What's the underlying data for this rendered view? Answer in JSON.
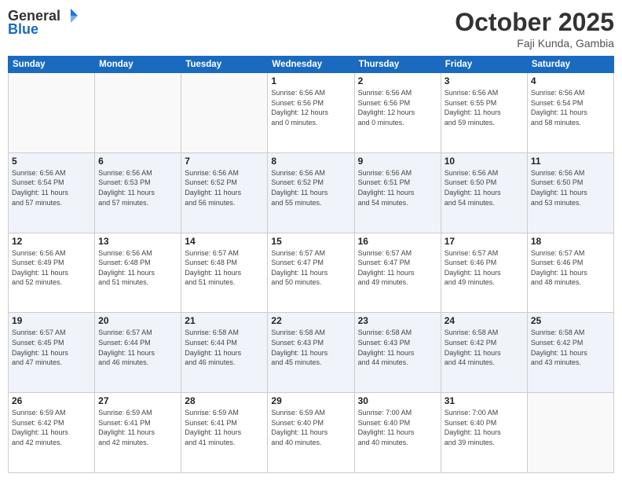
{
  "header": {
    "logo_line1": "General",
    "logo_line2": "Blue",
    "month": "October 2025",
    "location": "Faji Kunda, Gambia"
  },
  "days_of_week": [
    "Sunday",
    "Monday",
    "Tuesday",
    "Wednesday",
    "Thursday",
    "Friday",
    "Saturday"
  ],
  "weeks": [
    [
      {
        "num": "",
        "info": ""
      },
      {
        "num": "",
        "info": ""
      },
      {
        "num": "",
        "info": ""
      },
      {
        "num": "1",
        "info": "Sunrise: 6:56 AM\nSunset: 6:56 PM\nDaylight: 12 hours\nand 0 minutes."
      },
      {
        "num": "2",
        "info": "Sunrise: 6:56 AM\nSunset: 6:56 PM\nDaylight: 12 hours\nand 0 minutes."
      },
      {
        "num": "3",
        "info": "Sunrise: 6:56 AM\nSunset: 6:55 PM\nDaylight: 11 hours\nand 59 minutes."
      },
      {
        "num": "4",
        "info": "Sunrise: 6:56 AM\nSunset: 6:54 PM\nDaylight: 11 hours\nand 58 minutes."
      }
    ],
    [
      {
        "num": "5",
        "info": "Sunrise: 6:56 AM\nSunset: 6:54 PM\nDaylight: 11 hours\nand 57 minutes."
      },
      {
        "num": "6",
        "info": "Sunrise: 6:56 AM\nSunset: 6:53 PM\nDaylight: 11 hours\nand 57 minutes."
      },
      {
        "num": "7",
        "info": "Sunrise: 6:56 AM\nSunset: 6:52 PM\nDaylight: 11 hours\nand 56 minutes."
      },
      {
        "num": "8",
        "info": "Sunrise: 6:56 AM\nSunset: 6:52 PM\nDaylight: 11 hours\nand 55 minutes."
      },
      {
        "num": "9",
        "info": "Sunrise: 6:56 AM\nSunset: 6:51 PM\nDaylight: 11 hours\nand 54 minutes."
      },
      {
        "num": "10",
        "info": "Sunrise: 6:56 AM\nSunset: 6:50 PM\nDaylight: 11 hours\nand 54 minutes."
      },
      {
        "num": "11",
        "info": "Sunrise: 6:56 AM\nSunset: 6:50 PM\nDaylight: 11 hours\nand 53 minutes."
      }
    ],
    [
      {
        "num": "12",
        "info": "Sunrise: 6:56 AM\nSunset: 6:49 PM\nDaylight: 11 hours\nand 52 minutes."
      },
      {
        "num": "13",
        "info": "Sunrise: 6:56 AM\nSunset: 6:48 PM\nDaylight: 11 hours\nand 51 minutes."
      },
      {
        "num": "14",
        "info": "Sunrise: 6:57 AM\nSunset: 6:48 PM\nDaylight: 11 hours\nand 51 minutes."
      },
      {
        "num": "15",
        "info": "Sunrise: 6:57 AM\nSunset: 6:47 PM\nDaylight: 11 hours\nand 50 minutes."
      },
      {
        "num": "16",
        "info": "Sunrise: 6:57 AM\nSunset: 6:47 PM\nDaylight: 11 hours\nand 49 minutes."
      },
      {
        "num": "17",
        "info": "Sunrise: 6:57 AM\nSunset: 6:46 PM\nDaylight: 11 hours\nand 49 minutes."
      },
      {
        "num": "18",
        "info": "Sunrise: 6:57 AM\nSunset: 6:46 PM\nDaylight: 11 hours\nand 48 minutes."
      }
    ],
    [
      {
        "num": "19",
        "info": "Sunrise: 6:57 AM\nSunset: 6:45 PM\nDaylight: 11 hours\nand 47 minutes."
      },
      {
        "num": "20",
        "info": "Sunrise: 6:57 AM\nSunset: 6:44 PM\nDaylight: 11 hours\nand 46 minutes."
      },
      {
        "num": "21",
        "info": "Sunrise: 6:58 AM\nSunset: 6:44 PM\nDaylight: 11 hours\nand 46 minutes."
      },
      {
        "num": "22",
        "info": "Sunrise: 6:58 AM\nSunset: 6:43 PM\nDaylight: 11 hours\nand 45 minutes."
      },
      {
        "num": "23",
        "info": "Sunrise: 6:58 AM\nSunset: 6:43 PM\nDaylight: 11 hours\nand 44 minutes."
      },
      {
        "num": "24",
        "info": "Sunrise: 6:58 AM\nSunset: 6:42 PM\nDaylight: 11 hours\nand 44 minutes."
      },
      {
        "num": "25",
        "info": "Sunrise: 6:58 AM\nSunset: 6:42 PM\nDaylight: 11 hours\nand 43 minutes."
      }
    ],
    [
      {
        "num": "26",
        "info": "Sunrise: 6:59 AM\nSunset: 6:42 PM\nDaylight: 11 hours\nand 42 minutes."
      },
      {
        "num": "27",
        "info": "Sunrise: 6:59 AM\nSunset: 6:41 PM\nDaylight: 11 hours\nand 42 minutes."
      },
      {
        "num": "28",
        "info": "Sunrise: 6:59 AM\nSunset: 6:41 PM\nDaylight: 11 hours\nand 41 minutes."
      },
      {
        "num": "29",
        "info": "Sunrise: 6:59 AM\nSunset: 6:40 PM\nDaylight: 11 hours\nand 40 minutes."
      },
      {
        "num": "30",
        "info": "Sunrise: 7:00 AM\nSunset: 6:40 PM\nDaylight: 11 hours\nand 40 minutes."
      },
      {
        "num": "31",
        "info": "Sunrise: 7:00 AM\nSunset: 6:40 PM\nDaylight: 11 hours\nand 39 minutes."
      },
      {
        "num": "",
        "info": ""
      }
    ]
  ]
}
